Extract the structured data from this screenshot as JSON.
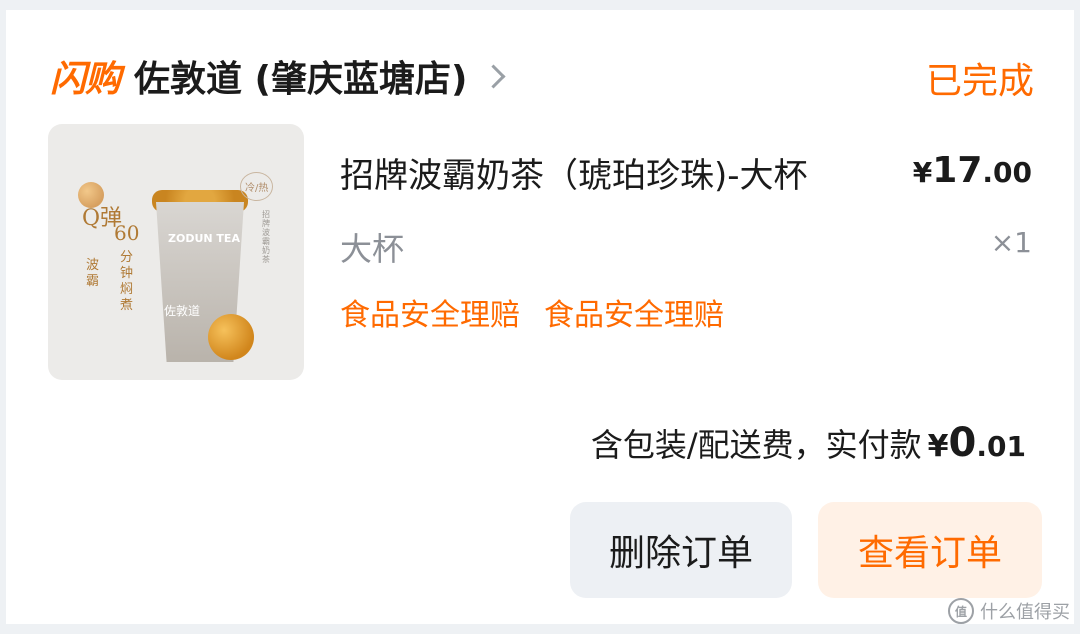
{
  "header": {
    "brand": "闪购",
    "store_name": "佐敦道 (肇庆蓝塘店)",
    "status": "已完成"
  },
  "thumbnail": {
    "cup_brand": "ZODUN TEA",
    "cup_label": "佐敦道",
    "hot_cold": "冷/热",
    "q_text": "Q弹",
    "q_sub": "波霸",
    "sixty": "60",
    "sixty_sub": "分钟焖煮",
    "side_text": "招牌波霸奶茶"
  },
  "item": {
    "name": "招牌波霸奶茶（琥珀珍珠)-大杯",
    "price_symbol": "¥",
    "price_int": "17",
    "price_dec": ".00",
    "spec": "大杯",
    "qty": "×1",
    "tags": [
      "食品安全理赔",
      "食品安全理赔"
    ]
  },
  "summary": {
    "label": "含包装/配送费，实付款",
    "symbol": "¥",
    "int": "0",
    "dec": ".01"
  },
  "actions": {
    "delete_label": "删除订单",
    "view_label": "查看订单"
  },
  "watermark": {
    "icon": "值",
    "text": "什么值得买"
  },
  "colors": {
    "accent": "#ff6a00",
    "secondary_button_bg": "#edf0f4",
    "primary_button_bg": "#fff1e6"
  }
}
